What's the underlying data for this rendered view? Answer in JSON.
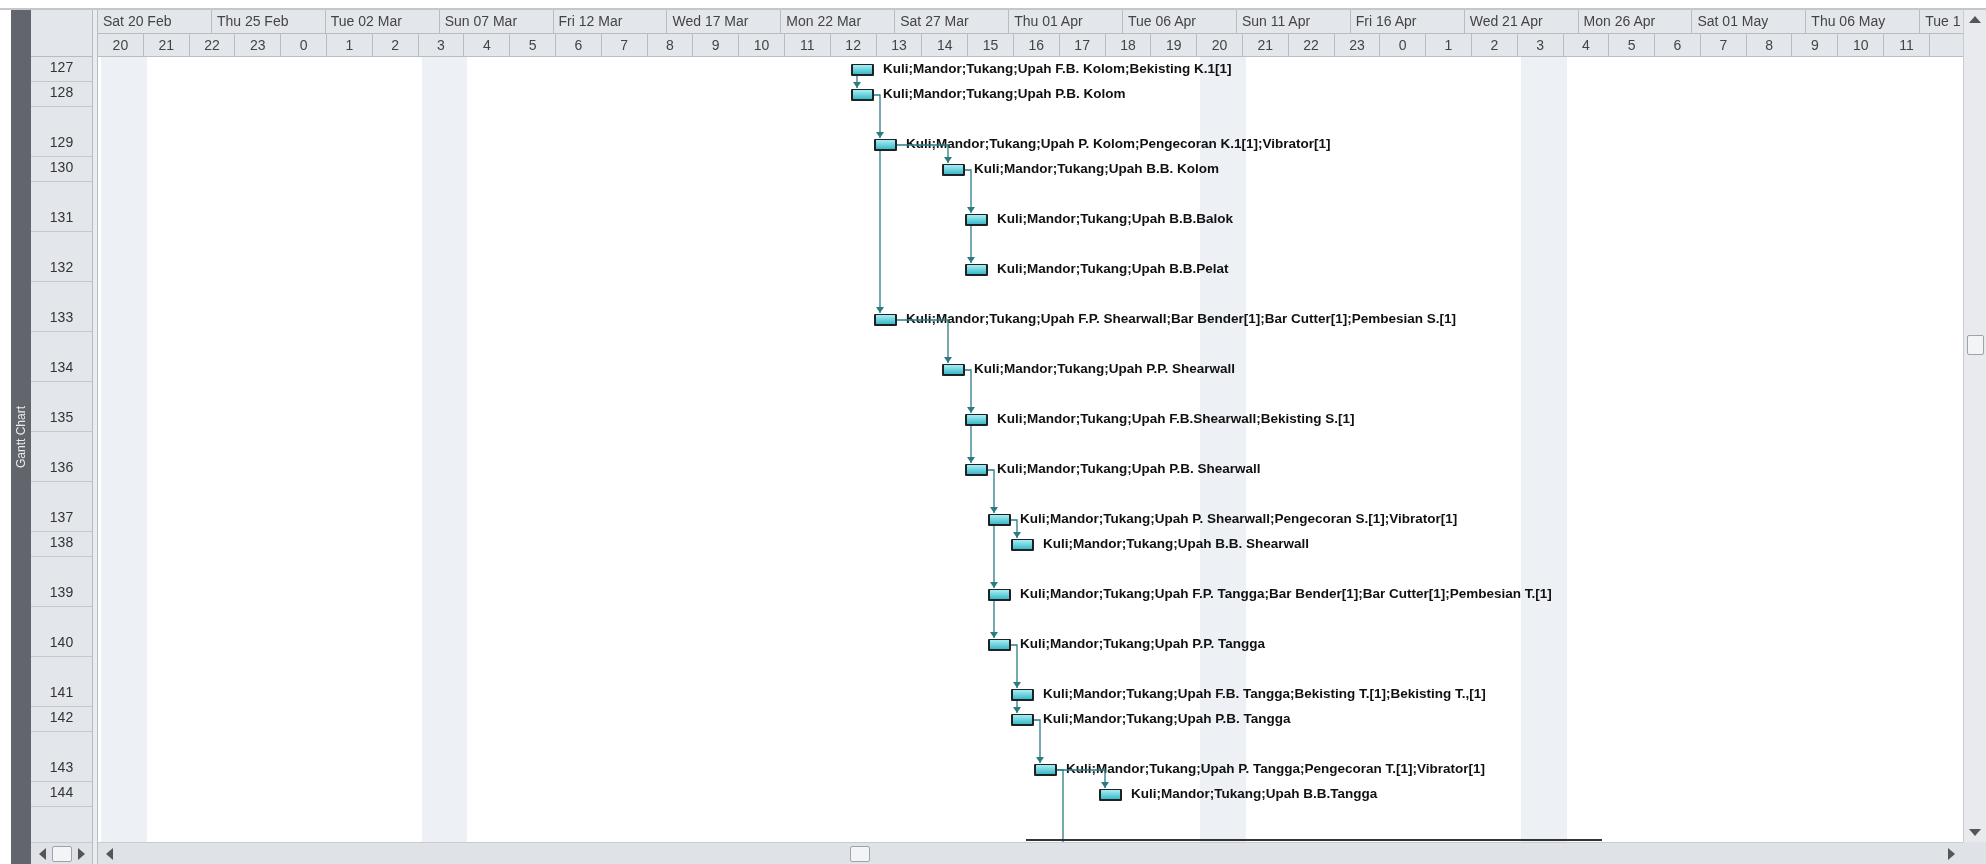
{
  "view_bar": {
    "label": "Gantt Chart"
  },
  "timescale": {
    "major": [
      "Sat 20 Feb",
      "Thu 25 Feb",
      "Tue 02 Mar",
      "Sun 07 Mar",
      "Fri 12 Mar",
      "Wed 17 Mar",
      "Mon 22 Mar",
      "Sat 27 Mar",
      "Thu 01 Apr",
      "Tue 06 Apr",
      "Sun 11 Apr",
      "Fri 16 Apr",
      "Wed 21 Apr",
      "Mon 26 Apr",
      "Sat 01 May",
      "Thu 06 May",
      "Tue 1"
    ],
    "minor": [
      {
        "label": "20",
        "nonworking": true
      },
      {
        "label": "21",
        "nonworking": false
      },
      {
        "label": "22",
        "nonworking": false
      },
      {
        "label": "23",
        "nonworking": false
      },
      {
        "label": "0",
        "nonworking": false
      },
      {
        "label": "1",
        "nonworking": false
      },
      {
        "label": "2",
        "nonworking": false
      },
      {
        "label": "3",
        "nonworking": true
      },
      {
        "label": "4",
        "nonworking": false
      },
      {
        "label": "5",
        "nonworking": false
      },
      {
        "label": "6",
        "nonworking": false
      },
      {
        "label": "7",
        "nonworking": false
      },
      {
        "label": "8",
        "nonworking": false
      },
      {
        "label": "9",
        "nonworking": false
      },
      {
        "label": "10",
        "nonworking": false
      },
      {
        "label": "11",
        "nonworking": false
      },
      {
        "label": "12",
        "nonworking": false
      },
      {
        "label": "13",
        "nonworking": false
      },
      {
        "label": "14",
        "nonworking": false
      },
      {
        "label": "15",
        "nonworking": false
      },
      {
        "label": "16",
        "nonworking": false
      },
      {
        "label": "17",
        "nonworking": false
      },
      {
        "label": "18",
        "nonworking": false
      },
      {
        "label": "19",
        "nonworking": false
      },
      {
        "label": "20",
        "nonworking": true
      },
      {
        "label": "21",
        "nonworking": false
      },
      {
        "label": "22",
        "nonworking": false
      },
      {
        "label": "23",
        "nonworking": false
      },
      {
        "label": "0",
        "nonworking": false
      },
      {
        "label": "1",
        "nonworking": false
      },
      {
        "label": "2",
        "nonworking": false
      },
      {
        "label": "3",
        "nonworking": true
      },
      {
        "label": "4",
        "nonworking": false
      },
      {
        "label": "5",
        "nonworking": false
      },
      {
        "label": "6",
        "nonworking": false
      },
      {
        "label": "7",
        "nonworking": false
      },
      {
        "label": "8",
        "nonworking": false
      },
      {
        "label": "9",
        "nonworking": false
      },
      {
        "label": "10",
        "nonworking": false
      },
      {
        "label": "11",
        "nonworking": false
      }
    ]
  },
  "tasks": [
    {
      "row": "127",
      "resources": "Kuli;Mandor;Tukang;Upah F.B. Kolom;Bekisting K.1[1]"
    },
    {
      "row": "128",
      "resources": "Kuli;Mandor;Tukang;Upah P.B. Kolom"
    },
    {
      "row": "129",
      "resources": "Kuli;Mandor;Tukang;Upah P. Kolom;Pengecoran K.1[1];Vibrator[1]"
    },
    {
      "row": "130",
      "resources": "Kuli;Mandor;Tukang;Upah B.B. Kolom"
    },
    {
      "row": "131",
      "resources": "Kuli;Mandor;Tukang;Upah B.B.Balok"
    },
    {
      "row": "132",
      "resources": "Kuli;Mandor;Tukang;Upah B.B.Pelat"
    },
    {
      "row": "133",
      "resources": "Kuli;Mandor;Tukang;Upah F.P. Shearwall;Bar Bender[1];Bar Cutter[1];Pembesian S.[1]"
    },
    {
      "row": "134",
      "resources": "Kuli;Mandor;Tukang;Upah P.P. Shearwall"
    },
    {
      "row": "135",
      "resources": "Kuli;Mandor;Tukang;Upah F.B.Shearwall;Bekisting S.[1]"
    },
    {
      "row": "136",
      "resources": "Kuli;Mandor;Tukang;Upah P.B. Shearwall"
    },
    {
      "row": "137",
      "resources": "Kuli;Mandor;Tukang;Upah P. Shearwall;Pengecoran S.[1];Vibrator[1]"
    },
    {
      "row": "138",
      "resources": "Kuli;Mandor;Tukang;Upah B.B. Shearwall"
    },
    {
      "row": "139",
      "resources": "Kuli;Mandor;Tukang;Upah F.P. Tangga;Bar Bender[1];Bar Cutter[1];Pembesian T.[1]"
    },
    {
      "row": "140",
      "resources": "Kuli;Mandor;Tukang;Upah P.P. Tangga"
    },
    {
      "row": "141",
      "resources": "Kuli;Mandor;Tukang;Upah F.B. Tangga;Bekisting T.[1];Bekisting T.,[1]"
    },
    {
      "row": "142",
      "resources": "Kuli;Mandor;Tukang;Upah P.B. Tangga"
    },
    {
      "row": "143",
      "resources": "Kuli;Mandor;Tukang;Upah P. Tangga;Pengecoran T.[1];Vibrator[1]"
    },
    {
      "row": "144",
      "resources": "Kuli;Mandor;Tukang;Upah B.B.Tangga"
    }
  ]
}
